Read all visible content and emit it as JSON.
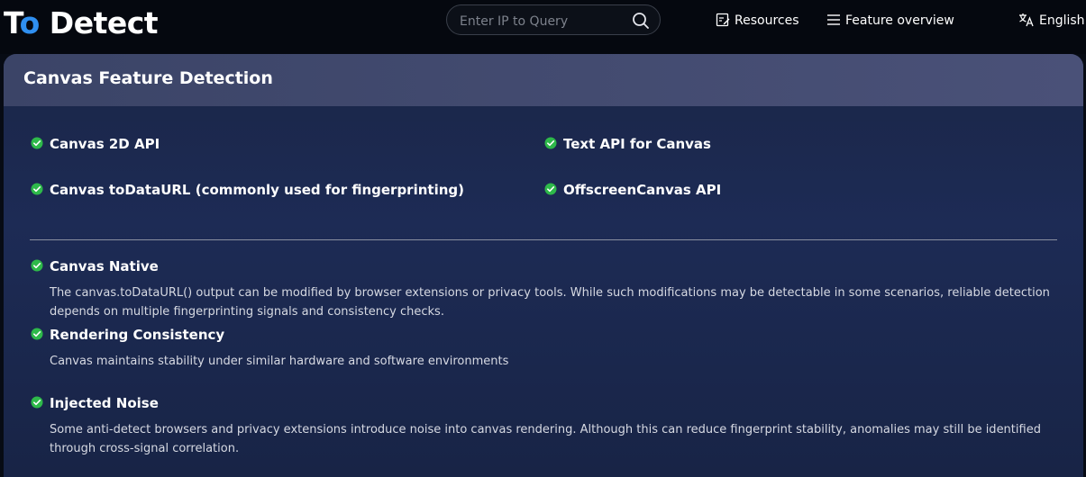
{
  "header": {
    "logo_text_a": "T",
    "logo_text_b": "o",
    "logo_text_c": " Detect",
    "search": {
      "placeholder": "Enter IP to Query",
      "value": ""
    },
    "nav": {
      "resources": "Resources",
      "feature_overview": "Feature overview",
      "language": "English"
    }
  },
  "panel": {
    "title": "Canvas Feature Detection",
    "features": [
      {
        "label": "Canvas 2D API",
        "status": "pass"
      },
      {
        "label": "Text API for Canvas",
        "status": "pass"
      },
      {
        "label": "Canvas toDataURL (commonly used for fingerprinting)",
        "status": "pass"
      },
      {
        "label": "OffscreenCanvas API",
        "status": "pass"
      }
    ],
    "checks": [
      {
        "title": "Canvas Native",
        "status": "pass",
        "description": "The canvas.toDataURL() output can be modified by browser extensions or privacy tools. While such modifications may be detectable in some scenarios, reliable detection depends on multiple fingerprinting signals and consistency checks."
      },
      {
        "title": "Rendering Consistency",
        "status": "pass",
        "description": "Canvas maintains stability under similar hardware and software environments"
      },
      {
        "title": "Injected Noise",
        "status": "pass",
        "description": "Some anti-detect browsers and privacy extensions introduce noise into canvas rendering. Although this can reduce fingerprint stability, anomalies may still be identified through cross-signal correlation."
      }
    ]
  },
  "colors": {
    "check_green": "#2eb94a",
    "logo_accent": "#2f8ff0",
    "panel_bg": "#1d2b55",
    "header_bg": "#404a6e"
  },
  "icons": {
    "search": "search-icon",
    "resources": "document-edit-icon",
    "feature_overview": "menu-icon",
    "language": "translate-icon",
    "status": "check-circle-icon"
  }
}
